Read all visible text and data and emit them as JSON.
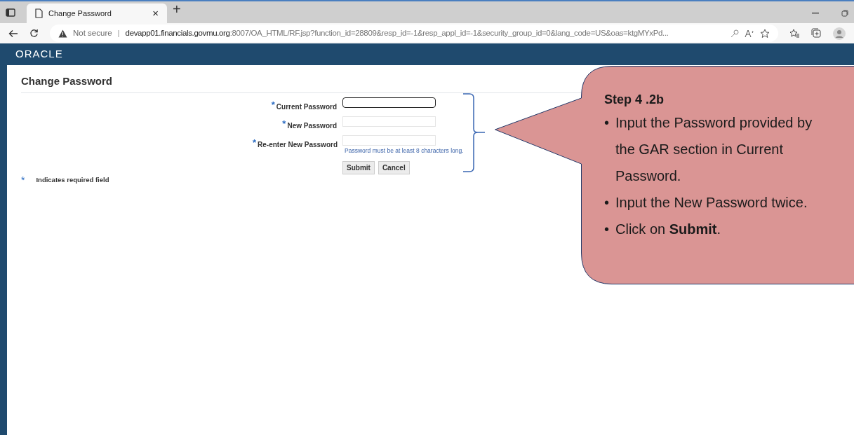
{
  "browser": {
    "tab_title": "Change Password",
    "tab_close": "×",
    "new_tab": "+",
    "security": "Not secure",
    "separator": "|",
    "host": "devapp01.financials.govmu.org",
    "path": ":8007/OA_HTML/RF.jsp?function_id=28809&resp_id=-1&resp_appl_id=-1&security_group_id=0&lang_code=US&oas=ktgMYxPd..."
  },
  "header": {
    "logo": "ORACLE"
  },
  "page": {
    "title": "Change Password",
    "fields": [
      {
        "label": "Current Password",
        "required_mark": "*",
        "focused": true
      },
      {
        "label": "New Password",
        "required_mark": "*",
        "focused": false
      },
      {
        "label": "Re-enter New Password",
        "required_mark": "*",
        "focused": false
      }
    ],
    "hint": "Password must be at least 8 characters long.",
    "buttons": [
      "Submit",
      "Cancel"
    ],
    "legend": {
      "mark": "*",
      "text": "Indicates required field"
    }
  },
  "callout": {
    "title": "Step 4 .2b",
    "bullets": [
      {
        "bullet": "•",
        "text": "Input the Password provided by the GAR section in Current Password."
      },
      {
        "bullet": "•",
        "text": "Input the New Password twice."
      },
      {
        "bullet": "•",
        "text": "Click on **Submit**."
      }
    ]
  }
}
